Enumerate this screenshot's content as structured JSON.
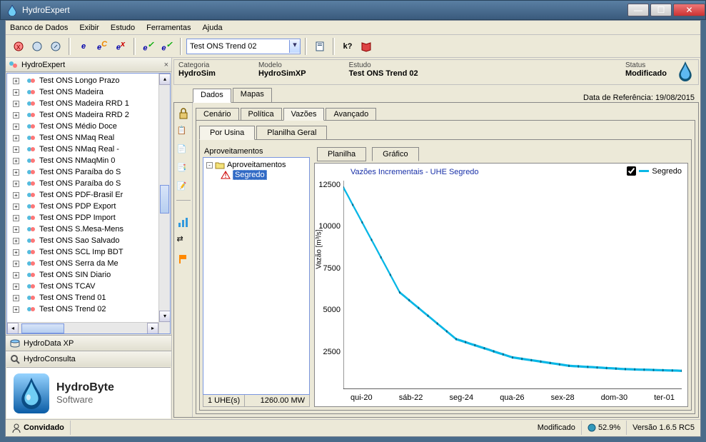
{
  "window": {
    "title": "HydroExpert"
  },
  "menubar": [
    "Banco de Dados",
    "Exibir",
    "Estudo",
    "Ferramentas",
    "Ajuda"
  ],
  "toolbar": {
    "select_value": "Test ONS Trend 02"
  },
  "sidebar": {
    "title": "HydroExpert",
    "tree": [
      "Test ONS Longo Prazo",
      "Test ONS Madeira",
      "Test ONS Madeira RRD 1",
      "Test ONS Madeira RRD 2",
      "Test ONS Médio Doce",
      "Test ONS NMaq Real",
      "Test ONS NMaq Real -",
      "Test ONS NMaqMin 0",
      "Test ONS Paraíba do S",
      "Test ONS Paraíba do S",
      "Test ONS PDF-Brasil Er",
      "Test ONS PDP Export",
      "Test ONS PDP Import",
      "Test ONS S.Mesa-Mens",
      "Test ONS Sao Salvado",
      "Test ONS SCL Imp BDT",
      "Test ONS Serra da Me",
      "Test ONS SIN Diario",
      "Test ONS TCAV",
      "Test ONS Trend 01",
      "Test ONS Trend 02"
    ],
    "panel1": "HydroData XP",
    "panel2": "HydroConsulta",
    "logo_top": "HydroByte",
    "logo_bottom": "Software"
  },
  "info": {
    "categoria_label": "Categoria",
    "categoria_value": "HydroSim",
    "modelo_label": "Modelo",
    "modelo_value": "HydroSimXP",
    "estudo_label": "Estudo",
    "estudo_value": "Test ONS Trend 02",
    "status_label": "Status",
    "status_value": "Modificado",
    "ref_date": "Data de Referência: 19/08/2015"
  },
  "tabs_main": {
    "dados": "Dados",
    "mapas": "Mapas"
  },
  "tabs_sub1": [
    "Cenário",
    "Política",
    "Vazões",
    "Avançado"
  ],
  "tabs_sub1_active": 2,
  "tabs_sub2": [
    "Por Usina",
    "Planilha Geral"
  ],
  "tabs_sub2_active": 0,
  "aprov": {
    "title": "Aproveitamentos",
    "root": "Aproveitamentos",
    "child": "Segredo",
    "foot_left": "1 UHE(s)",
    "foot_right": "1260.00 MW"
  },
  "chart_tabs": {
    "planilha": "Planilha",
    "grafico": "Gráfico"
  },
  "chart": {
    "title": "Vazões Incrementais - UHE Segredo",
    "ylabel": "Vazão [m³/s]",
    "legend_name": "Segredo",
    "y_ticks": [
      "12500",
      "10000",
      "7500",
      "5000",
      "2500",
      ""
    ],
    "x_ticks": [
      "qui-20",
      "sáb-22",
      "seg-24",
      "qua-26",
      "sex-28",
      "dom-30",
      "ter-01"
    ]
  },
  "chart_data": {
    "type": "line",
    "title": "Vazões Incrementais - UHE Segredo",
    "xlabel": "",
    "ylabel": "Vazão [m³/s]",
    "ylim": [
      0,
      12500
    ],
    "categories": [
      "qui-20",
      "sáb-22",
      "seg-24",
      "qua-26",
      "sex-28",
      "dom-30",
      "ter-01"
    ],
    "series": [
      {
        "name": "Segredo",
        "color": "#09b7e6",
        "values": [
          12100,
          5800,
          3000,
          1900,
          1400,
          1200,
          1100
        ]
      }
    ]
  },
  "statusbar": {
    "user": "Convidado",
    "status": "Modificado",
    "progress": "52.9%",
    "version": "Versão 1.6.5 RC5"
  }
}
